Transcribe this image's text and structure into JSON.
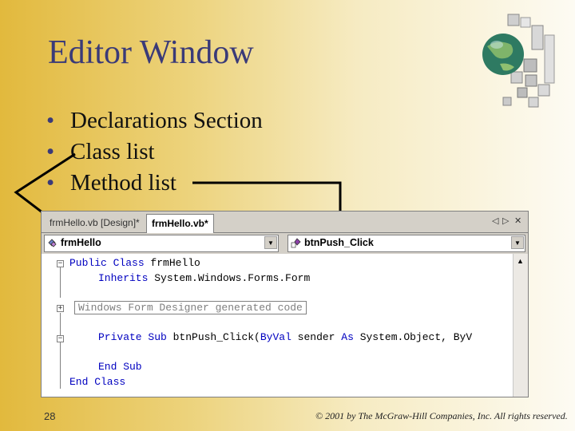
{
  "slide": {
    "title": "Editor Window",
    "bullets": [
      "Declarations Section",
      "Class list",
      "Method list"
    ],
    "bullet_char": "•",
    "number": "28",
    "copyright": "© 2001 by The McGraw-Hill Companies, Inc. All rights reserved."
  },
  "editor": {
    "tabs": [
      "frmHello.vb [Design]*",
      "frmHello.vb*"
    ],
    "tab_nav": {
      "prev": "◁",
      "next": "▷",
      "close": "✕"
    },
    "class_list": {
      "value": "frmHello",
      "icon": "class-icon"
    },
    "method_list": {
      "value": "btnPush_Click",
      "icon": "method-icon"
    },
    "dropdown_glyph": "▼",
    "scroll_up_glyph": "▲",
    "fold_minus": "−",
    "fold_plus": "+",
    "code": {
      "l1": {
        "kw": "Public Class",
        "rest": " frmHello"
      },
      "l2": {
        "kw": "Inherits",
        "rest": " System.Windows.Forms.Form"
      },
      "l3": {
        "region": "Windows Form Designer generated code"
      },
      "l4": {
        "kw1": "Private Sub",
        "mid": " btnPush_Click(",
        "kw2": "ByVal",
        "mid2": " sender ",
        "kw3": "As",
        "rest": " System.Object, ByV"
      },
      "l5": {
        "kw": "End Sub"
      },
      "l6": {
        "kw": "End Class"
      }
    }
  },
  "colors": {
    "keyword": "#0000c0",
    "title": "#3a3a78",
    "background_start": "#e2b93d"
  }
}
